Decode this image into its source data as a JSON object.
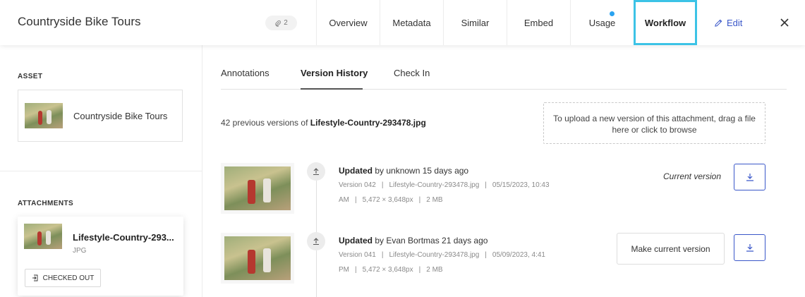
{
  "header": {
    "title": "Countryside Bike Tours",
    "attachment_count": "2",
    "nav": [
      "Overview",
      "Metadata",
      "Similar",
      "Embed",
      "Usage",
      "Workflow"
    ],
    "active_nav": "Workflow",
    "edit_label": "Edit",
    "accent_color": "#3cc3e6",
    "link_color": "#3a57c9"
  },
  "left": {
    "asset_label": "ASSET",
    "asset_name": "Countryside Bike Tours",
    "attachments_label": "ATTACHMENTS",
    "attachment": {
      "name": "Lifestyle-Country-293...",
      "type": "JPG",
      "status": "CHECKED OUT"
    }
  },
  "right": {
    "tabs": [
      "Annotations",
      "Version History",
      "Check In"
    ],
    "active_tab": "Version History",
    "prev_prefix": "42 previous versions of ",
    "prev_file": "Lifestyle-Country-293478.jpg",
    "dropzone_text": "To upload a new version of this attachment, drag a file here or click to browse",
    "versions": [
      {
        "action": "Updated",
        "by": " by unknown 15 days ago",
        "version": "Version 042",
        "file": "Lifestyle-Country-293478.jpg",
        "date": "05/15/2023, 10:43",
        "time_suffix": "AM",
        "dimensions": "5,472 × 3,648px",
        "size": "2 MB",
        "current_label": "Current version"
      },
      {
        "action": "Updated",
        "by": " by Evan Bortmas 21 days ago",
        "version": "Version 041",
        "file": "Lifestyle-Country-293478.jpg",
        "date": "05/09/2023, 4:41",
        "time_suffix": "PM",
        "dimensions": "5,472 × 3,648px",
        "size": "2 MB",
        "make_current_label": "Make current version"
      }
    ]
  }
}
